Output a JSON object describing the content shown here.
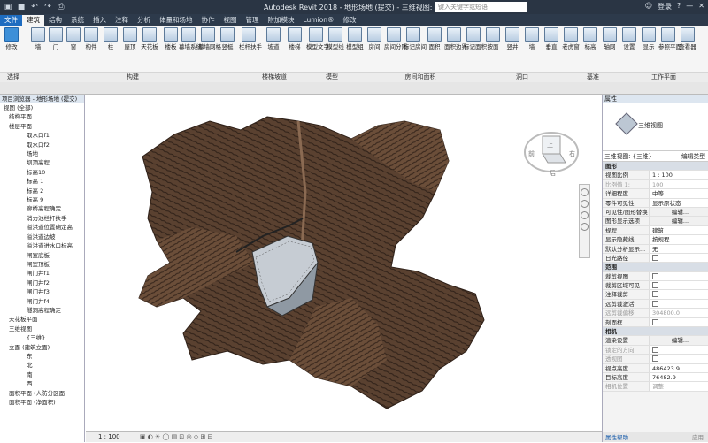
{
  "app": {
    "title": "Autodesk Revit 2018 -   地形场地 (提交) - 三维视图: {三维}",
    "search_placeholder": "键入关键字或短语",
    "user_label": "登录"
  },
  "tabs": [
    "文件",
    "建筑",
    "结构",
    "系统",
    "插入",
    "注释",
    "分析",
    "体量和场地",
    "协作",
    "视图",
    "管理",
    "附加模块",
    "Lumion®",
    "修改"
  ],
  "ribbon": {
    "modify_label": "修改",
    "buttons": [
      "墙",
      "门",
      "窗",
      "构件",
      "柱",
      "屋顶",
      "天花板",
      "楼板",
      "幕墙系统",
      "幕墙网格",
      "竖梃",
      "栏杆扶手",
      "坡道",
      "楼梯",
      "模型文字",
      "模型线",
      "模型组",
      "房间",
      "房间分隔",
      "标记房间",
      "面积",
      "面积边界",
      "标记面积",
      "按面",
      "竖井",
      "墙",
      "垂直",
      "老虎窗",
      "标高",
      "轴网",
      "设置",
      "显示",
      "参照平面",
      "查看器"
    ],
    "groups": [
      "选择",
      "构建",
      "楼梯坡道",
      "模型",
      "房间和面积",
      "洞口",
      "基准",
      "工作平面"
    ]
  },
  "project_browser": {
    "title": "项目浏览器 - 地形场地 (提交)",
    "items": [
      "视图 (全部)",
      "结构平面",
      "楼层平面",
      "取水口f1",
      "取水口f2",
      "场地",
      "坝顶高程",
      "标高10",
      "标高 1",
      "标高 2",
      "标高 9",
      "廊桥高程确定",
      "消力池栏杆扶手",
      "溢洪道位置确定高",
      "溢洪道边坡",
      "溢洪道进水口标高",
      "闸室底板",
      "闸室顶板",
      "闸门井f1",
      "闸门井f2",
      "闸门井f3",
      "闸门井f4",
      "隧洞高程确定",
      "天花板平面",
      "三维视图",
      "{三维}",
      "立面 (建筑立面)",
      "东",
      "北",
      "南",
      "西",
      "面积平面 (人防分区面",
      "面积平面 (净面积)"
    ]
  },
  "properties": {
    "title": "属性",
    "type_name": "三维视图",
    "selector": "三维视图: {三维}",
    "edit_type": "编辑类型",
    "rows": [
      {
        "k": "图形",
        "v": "",
        "sec": true
      },
      {
        "k": "视图比例",
        "v": "1 : 100"
      },
      {
        "k": "比例值 1:",
        "v": "100",
        "dis": true
      },
      {
        "k": "详细程度",
        "v": "中等"
      },
      {
        "k": "零件可见性",
        "v": "显示原状态"
      },
      {
        "k": "可见性/图形替换",
        "v": "编辑...",
        "btn": true
      },
      {
        "k": "图形显示选项",
        "v": "编辑...",
        "btn": true
      },
      {
        "k": "规程",
        "v": "建筑"
      },
      {
        "k": "显示隐藏线",
        "v": "按规程"
      },
      {
        "k": "默认分析显示...",
        "v": "无"
      },
      {
        "k": "日光路径",
        "v": "",
        "cb": true
      },
      {
        "k": "范围",
        "v": "",
        "sec": true
      },
      {
        "k": "裁剪视图",
        "v": "",
        "cb": true
      },
      {
        "k": "裁剪区域可见",
        "v": "",
        "cb": true
      },
      {
        "k": "注释裁剪",
        "v": "",
        "cb": true
      },
      {
        "k": "远剪裁激活",
        "v": "",
        "cb": true
      },
      {
        "k": "远剪裁偏移",
        "v": "304800.0",
        "dis": true
      },
      {
        "k": "剖面框",
        "v": "",
        "cb": true
      },
      {
        "k": "相机",
        "v": "",
        "sec": true
      },
      {
        "k": "渲染设置",
        "v": "编辑...",
        "btn": true
      },
      {
        "k": "锁定的方向",
        "v": "",
        "cb": true,
        "dis": true
      },
      {
        "k": "透视图",
        "v": "",
        "cb": true,
        "dis": true
      },
      {
        "k": "视点高度",
        "v": "486423.9"
      },
      {
        "k": "目标高度",
        "v": "76482.9"
      },
      {
        "k": "相机位置",
        "v": "调整",
        "dis": true
      }
    ],
    "help": "属性帮助",
    "apply": "应用"
  },
  "viewcube": {
    "top": "上",
    "front": "前",
    "right": "右",
    "back": "后"
  },
  "status": {
    "scale": "1 : 100"
  },
  "colors": {
    "terrain": "#5a4130",
    "terrain_dark": "#2e2018",
    "terrain_light": "#8a6a52"
  }
}
